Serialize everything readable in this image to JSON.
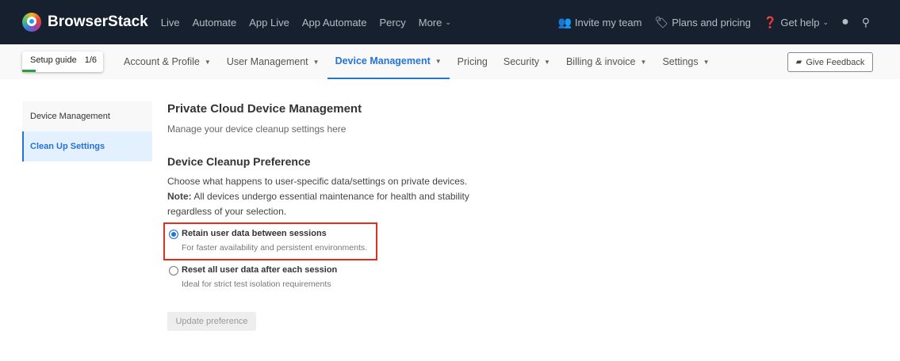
{
  "header": {
    "brand": "BrowserStack",
    "products": [
      "Live",
      "Automate",
      "App Live",
      "App Automate",
      "Percy",
      "More"
    ],
    "invite": "Invite my team",
    "plans": "Plans and pricing",
    "help": "Get help"
  },
  "subnav": {
    "setup_label": "Setup guide",
    "setup_count": "1/6",
    "setup_progress": 0.17,
    "items": [
      "Account & Profile",
      "User Management",
      "Device Management",
      "Pricing",
      "Security",
      "Billing & invoice",
      "Settings"
    ],
    "feedback": "Give Feedback"
  },
  "sidebar": {
    "items": [
      "Device Management",
      "Clean Up Settings"
    ]
  },
  "main": {
    "title": "Private Cloud Device Management",
    "subtitle": "Manage your device cleanup settings here",
    "section": "Device Cleanup Preference",
    "body": "Choose what happens to user-specific data/settings on private devices.",
    "note_label": "Note:",
    "note": " All devices undergo essential maintenance for health and stability regardless of your selection.",
    "options": [
      {
        "label": "Retain user data between sessions",
        "desc": "For faster availability and persistent environments.",
        "selected": true
      },
      {
        "label": "Reset all user data after each session",
        "desc": "Ideal for strict test isolation requirements",
        "selected": false
      }
    ],
    "button": "Update preference"
  }
}
